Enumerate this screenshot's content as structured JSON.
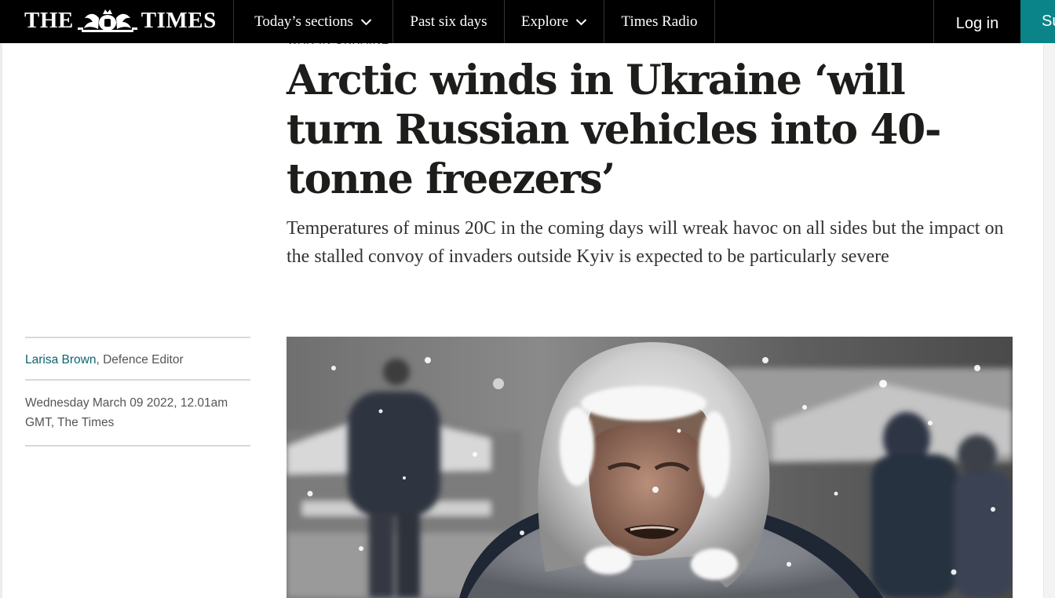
{
  "nav": {
    "logo_left": "THE",
    "logo_right": "TIMES",
    "crest_icon": "royal-crest-icon",
    "items": [
      {
        "label": "Today’s sections",
        "has_dropdown": true
      },
      {
        "label": "Past six days",
        "has_dropdown": false
      },
      {
        "label": "Explore",
        "has_dropdown": true
      },
      {
        "label": "Times Radio",
        "has_dropdown": false
      }
    ],
    "login": "Log in",
    "subscribe": "Subscribe",
    "subscribe_color": "#0a8489"
  },
  "article": {
    "kicker": "War in Ukraine",
    "headline": "Arctic winds in Ukraine ‘will turn Russian vehicles into 40-tonne freezers’",
    "standfirst": "Temperatures of minus 20C in the coming days will wreak havoc on all sides but the impact on the stalled convoy of invaders outside Kyiv is expected to be particularly severe",
    "author": "Larisa Brown",
    "author_role": ", Defence Editor",
    "date": "Wednesday March 09 2022, 12.01am GMT, The Times",
    "author_link_color": "#0a6470"
  }
}
